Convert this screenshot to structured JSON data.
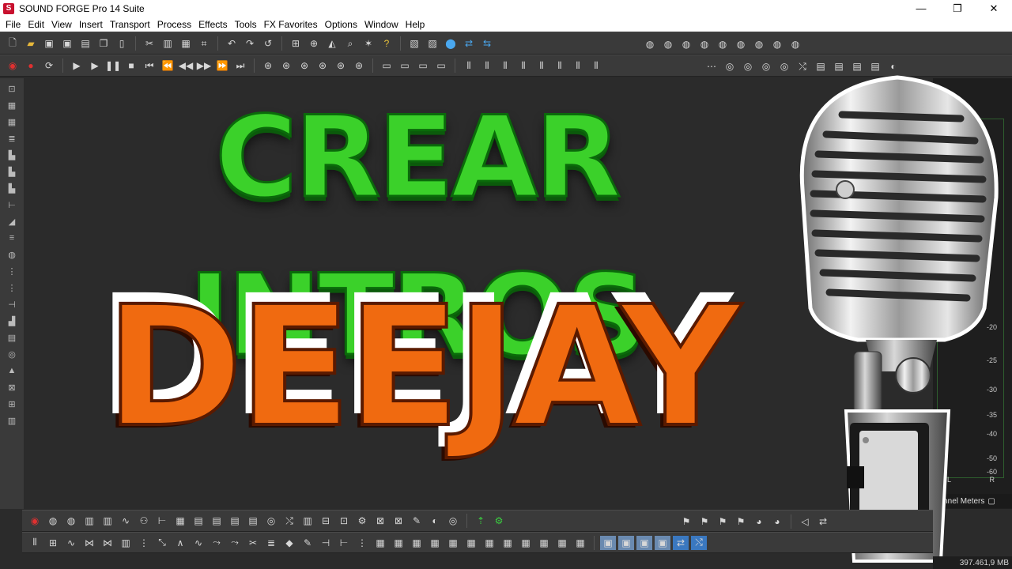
{
  "window": {
    "title": "SOUND FORGE Pro 14 Suite",
    "logo_letter": "S",
    "minimize": "—",
    "maximize": "❐",
    "close": "✕"
  },
  "menu": [
    "File",
    "Edit",
    "View",
    "Insert",
    "Transport",
    "Process",
    "Effects",
    "Tools",
    "FX Favorites",
    "Options",
    "Window",
    "Help"
  ],
  "toolbar_top_icons": [
    "new-file-icon",
    "open-folder-icon",
    "save-icon",
    "save-all-icon",
    "print-icon",
    "copy-icon",
    "cut-icon",
    "paste-icon",
    "crop-icon",
    "undo-icon",
    "redo-icon",
    "repeat-icon",
    "zoom-icon",
    "find-icon",
    "render-icon",
    "wand-icon",
    "help-icon"
  ],
  "transport_icons": [
    "record-dot-icon",
    "record-icon",
    "loop-icon",
    "play-all-icon",
    "play-icon",
    "pause-icon",
    "stop-icon",
    "go-start-icon",
    "rewind-icon",
    "fast-rewind-icon",
    "fast-forward-icon",
    "go-end-forward-icon",
    "go-end-icon"
  ],
  "headline": {
    "line1": "CREAR INTROS",
    "line2": "DEEJAY"
  },
  "meters": {
    "db_labels": [
      "-20",
      "-25",
      "-30",
      "-35",
      "-40",
      "-50",
      "-60"
    ],
    "left": "L",
    "right": "R",
    "panel_title": "hannel Meters"
  },
  "status": {
    "memory": "397.461,9 MB"
  },
  "colors": {
    "headline1": "#3bd12a",
    "headline2": "#f06a10",
    "workspace": "#2b2b2b",
    "toolbar": "#3a3a3a"
  }
}
